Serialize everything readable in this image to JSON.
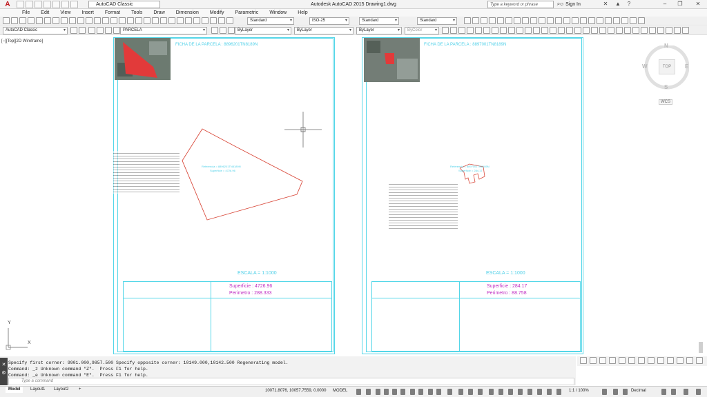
{
  "titlebar": {
    "app_title": "Autodesk AutoCAD 2015   Drawing1.dwg",
    "workspace": "AutoCAD Classic",
    "search_placeholder": "Type a keyword or phrase",
    "sign_in": "Sign In"
  },
  "menu": [
    "File",
    "Edit",
    "View",
    "Insert",
    "Format",
    "Tools",
    "Draw",
    "Dimension",
    "Modify",
    "Parametric",
    "Window",
    "Help"
  ],
  "toolbar1": {
    "text_style": "Standard",
    "dim_style": "ISO-25",
    "table_style": "Standard",
    "multileader_style": "Standard"
  },
  "toolbar2": {
    "workspace": "AutoCAD Classic",
    "layer": "PARCELA",
    "color": "ByLayer",
    "linetype": "ByLayer",
    "lineweight": "ByLayer",
    "plotstyle": "ByColor"
  },
  "viewport_label": "[−][Top][2D Wireframe]",
  "viewcube": {
    "north": "N",
    "south": "S",
    "east": "E",
    "west": "W",
    "top": "TOP",
    "wcs": "WCS"
  },
  "ucs": {
    "x": "X",
    "y": "Y"
  },
  "sheets": [
    {
      "ficha": "FICHA DE LA PARCELA : 8896201TN8189N",
      "escala": "ESCALA =  1:1000",
      "superficie": "Superficie : 4726.96",
      "perimetro": "Perimetro : 288.333",
      "label_ref": "Referencia = 8896201TN8189N",
      "label_sup": "Superficie = 4726.96"
    },
    {
      "ficha": "FICHA DE LA PARCELA : 8897001TN8189N",
      "escala": "ESCALA =  1:1000",
      "superficie": "Superficie : 284.17",
      "perimetro": "Perimetro : 88.758",
      "label_ref": "Referencia = 8897001TN8189N",
      "label_sup": "Superficie = 284.17"
    }
  ],
  "command_history": [
    "Specify first corner: 9901.000,9857.500 Specify opposite corner: 10149.000,10142.500 Regenerating model.",
    "Command: _z Unknown command \"Z\".  Press F1 for help.",
    "Command: _e Unknown command \"E\".  Press F1 for help."
  ],
  "command_placeholder": "Type a command",
  "status": {
    "tabs": [
      "Model",
      "Layout1",
      "Layout2"
    ],
    "coordinates": "10071.8076, 10057.7559, 0.0000",
    "mode": "MODEL",
    "scale": "1:1 / 100%",
    "units": "Decimal"
  },
  "colors": {
    "accent": "#53d6e8",
    "magenta": "#c02fc2",
    "parcel": "#d94a3c",
    "app_red": "#c0161b"
  }
}
